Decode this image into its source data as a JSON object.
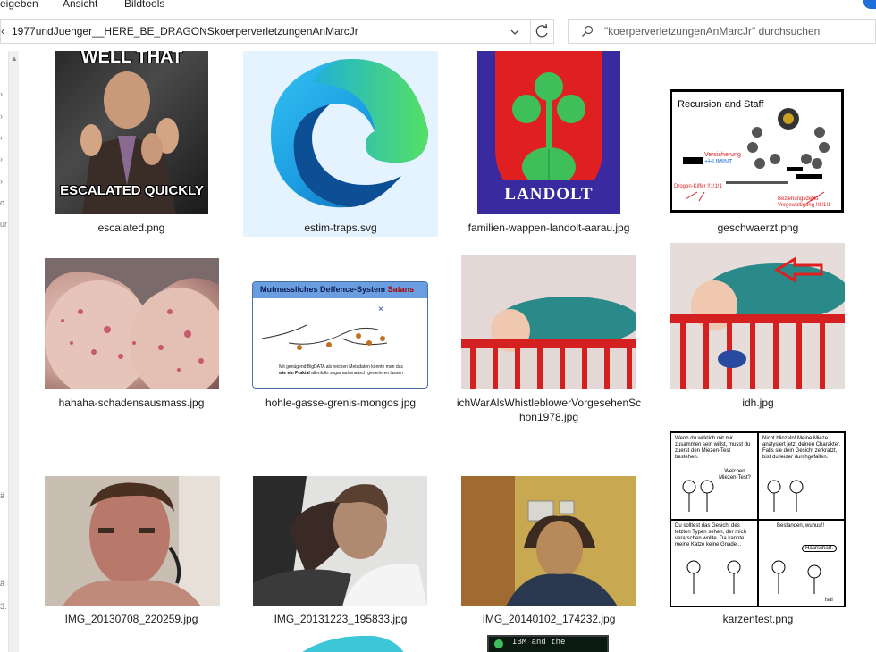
{
  "ribbon": {
    "tabs": [
      "eigeben",
      "Ansicht",
      "Bildtools"
    ]
  },
  "address": {
    "crumbs": [
      "1977undJuenger__HERE_BE_DRAGONS",
      "koerperverletzungenAnMarcJr"
    ]
  },
  "search": {
    "placeholder": "\"koerperverletzungenAnMarcJr\" durchsuchen"
  },
  "files": [
    {
      "name": "escalated.png",
      "meme_top": "WELL THAT",
      "meme_bottom": "ESCALATED QUICKLY"
    },
    {
      "name": "estim-traps.svg",
      "selected": true
    },
    {
      "name": "familien-wappen-landolt-aarau.jpg",
      "crest_text": "LANDOLT"
    },
    {
      "name": "geschwaerzt.png",
      "title": "Recursion and Staff",
      "label_a": "Versicherung",
      "label_b": "+HUMINT",
      "label_c": "Drogen-Kiffer !!1!1!1",
      "label_d": "Beziehungsdelikt",
      "label_e": "Vergewaltigung !!1!1!1"
    },
    {
      "name": "hahaha-schadensausmass.jpg"
    },
    {
      "name": "hohle-gasse-grenis-mongos.jpg",
      "title_a": "Mutmassliches Deffence-System ",
      "title_b": "Satans",
      "caption_a": "Mit genügend BigDATA als reichen Metadaten könnte man das",
      "caption_b": "wie ein Praktal",
      "caption_c": " allenfalls sogar automatisch generieren lassen"
    },
    {
      "name": "ichWarAlsWhistleblowerVorgesehenSchon1978.jpg",
      "name_line1": "ichWarAlsWhistleblowerVorgesehenSc",
      "name_line2": "hon1978.jpg"
    },
    {
      "name": "idh.jpg"
    },
    {
      "name": "IMG_20130708_220259.jpg"
    },
    {
      "name": "IMG_20131223_195833.jpg"
    },
    {
      "name": "IMG_20140102_174232.jpg"
    },
    {
      "name": "karzentest.png",
      "p1": "Wenn du wirklich mit mir zusammen sein willst, musst du zuerst den Miezen-Test bestehen.",
      "p1b": "Welchen Miezen-Test?",
      "p2": "Nicht blinzeln! Meine Mieze analysiert jetzt deinen Charakter. Falls sie dein Gesicht zerkratzt, bist du leider durchgefallen.",
      "p3": "Du solltest das Gesicht des letzten Typen sehen, der mich verarschen wollte. Da kannte meine Katze keine Gnade...",
      "p4": "Bestanden, wuhuu!!",
      "p4b": "Haarscharf.",
      "sig": "isiti"
    },
    {
      "name": "",
      "partial": true
    },
    {
      "name": "",
      "partial": true,
      "snippet": "IBM and the"
    }
  ],
  "colors": {
    "selection": "#e5f3ff",
    "accent": "#1e6fd9"
  }
}
